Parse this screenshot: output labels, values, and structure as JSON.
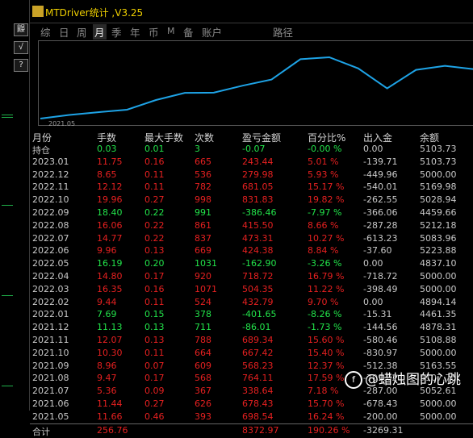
{
  "window": {
    "title": "MTDriver统计 ,V3.25"
  },
  "sidebar": {
    "buttons": [
      "鼹",
      "√",
      "?"
    ]
  },
  "tabs": [
    {
      "label": "综",
      "active": false
    },
    {
      "label": "日",
      "active": false
    },
    {
      "label": "周",
      "active": false
    },
    {
      "label": "月",
      "active": true
    },
    {
      "label": "季",
      "active": false
    },
    {
      "label": "年",
      "active": false
    },
    {
      "label": "币",
      "active": false
    },
    {
      "label": "M",
      "active": false
    },
    {
      "label": "备",
      "active": false
    },
    {
      "label": "账户",
      "active": false
    },
    {
      "label": "路径",
      "active": false
    }
  ],
  "chart_data": {
    "type": "line",
    "x_label": "2021.05",
    "line_color": "#1ea3e6",
    "series": [
      {
        "values": [
          4838,
          4861,
          4878,
          4894,
          4955,
          5000,
          5001,
          5045,
          5084,
          5212,
          5224,
          5154,
          5028,
          5145,
          5170,
          5149
        ]
      }
    ]
  },
  "table": {
    "headers": [
      "月份",
      "手数",
      "最大手数",
      "次数",
      "盈亏金额",
      "百分比%",
      "出入金",
      "余额"
    ],
    "colors": {
      "profit": "#e62020",
      "loss": "#22e34a",
      "neutral": "#c8c8c8"
    },
    "rows": [
      [
        "持仓",
        "0.03",
        "0.01",
        "3",
        "-0.07",
        "-0.00 %",
        "0.00",
        "5103.73",
        "loss"
      ],
      [
        "2023.01",
        "11.75",
        "0.16",
        "665",
        "243.44",
        "5.01 %",
        "-139.71",
        "5103.73",
        "profit"
      ],
      [
        "2022.12",
        "8.65",
        "0.11",
        "536",
        "279.98",
        "5.93 %",
        "-449.96",
        "5000.00",
        "profit"
      ],
      [
        "2022.11",
        "12.12",
        "0.11",
        "782",
        "681.05",
        "15.17 %",
        "-540.01",
        "5169.98",
        "profit"
      ],
      [
        "2022.10",
        "19.96",
        "0.27",
        "998",
        "831.83",
        "19.82 %",
        "-262.55",
        "5028.94",
        "profit"
      ],
      [
        "2022.09",
        "18.40",
        "0.22",
        "991",
        "-386.46",
        "-7.97 %",
        "-366.06",
        "4459.66",
        "loss"
      ],
      [
        "2022.08",
        "16.06",
        "0.22",
        "861",
        "415.50",
        "8.66 %",
        "-287.28",
        "5212.18",
        "profit"
      ],
      [
        "2022.07",
        "14.77",
        "0.22",
        "837",
        "473.31",
        "10.27 %",
        "-613.23",
        "5083.96",
        "profit"
      ],
      [
        "2022.06",
        "9.96",
        "0.13",
        "669",
        "424.38",
        "8.84 %",
        "-37.60",
        "5223.88",
        "profit"
      ],
      [
        "2022.05",
        "16.19",
        "0.20",
        "1031",
        "-162.90",
        "-3.26 %",
        "0.00",
        "4837.10",
        "loss"
      ],
      [
        "2022.04",
        "14.80",
        "0.17",
        "920",
        "718.72",
        "16.79 %",
        "-718.72",
        "5000.00",
        "profit"
      ],
      [
        "2022.03",
        "16.35",
        "0.16",
        "1071",
        "504.35",
        "11.22 %",
        "-398.49",
        "5000.00",
        "profit"
      ],
      [
        "2022.02",
        "9.44",
        "0.11",
        "524",
        "432.79",
        "9.70 %",
        "0.00",
        "4894.14",
        "profit"
      ],
      [
        "2022.01",
        "7.69",
        "0.15",
        "378",
        "-401.65",
        "-8.26 %",
        "-15.31",
        "4461.35",
        "loss"
      ],
      [
        "2021.12",
        "11.13",
        "0.13",
        "711",
        "-86.01",
        "-1.73 %",
        "-144.56",
        "4878.31",
        "loss"
      ],
      [
        "2021.11",
        "12.07",
        "0.13",
        "788",
        "689.34",
        "15.60 %",
        "-580.46",
        "5108.88",
        "profit"
      ],
      [
        "2021.10",
        "10.30",
        "0.11",
        "664",
        "667.42",
        "15.40 %",
        "-830.97",
        "5000.00",
        "profit"
      ],
      [
        "2021.09",
        "8.96",
        "0.07",
        "609",
        "568.23",
        "12.37 %",
        "-512.38",
        "5163.55",
        "profit"
      ],
      [
        "2021.08",
        "9.47",
        "0.17",
        "568",
        "764.11",
        "17.59 %",
        "-709.02",
        "5107.70",
        "profit"
      ],
      [
        "2021.07",
        "5.36",
        "0.09",
        "367",
        "338.64",
        "7.18 %",
        "-287.00",
        "5052.61",
        "profit"
      ],
      [
        "2021.06",
        "11.44",
        "0.27",
        "626",
        "678.43",
        "15.70 %",
        "-678.43",
        "5000.00",
        "profit"
      ],
      [
        "2021.05",
        "11.66",
        "0.46",
        "393",
        "698.54",
        "16.24 %",
        "-200.00",
        "5000.00",
        "profit"
      ]
    ],
    "total": [
      "合计",
      "256.76",
      "",
      "",
      "8372.97",
      "190.26 %",
      "-3269.31",
      "",
      "profit"
    ]
  },
  "watermark": {
    "text": "@蜡烛图的心跳",
    "logo": "f"
  }
}
